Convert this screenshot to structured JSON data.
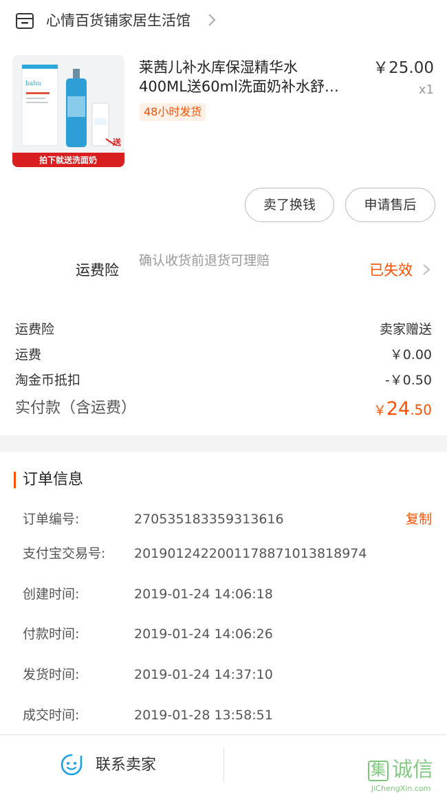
{
  "shop": {
    "name": "心情百货铺家居生活馆"
  },
  "product": {
    "title_line1": "莱茜儿补水库保湿精华水",
    "title_line2": "400ML送60ml洗面奶补水舒…",
    "ship_tag": "48小时发货",
    "price": "￥25.00",
    "quantity": "x1",
    "image_brand_text": "bahu",
    "image_gift_tag": "送",
    "image_banner": "拍下就送洗面奶"
  },
  "actions": {
    "sell_label": "卖了换钱",
    "after_sale_label": "申请售后"
  },
  "insurance": {
    "label": "运费险",
    "description": "确认收货前退货可理赔",
    "status": "已失效"
  },
  "costs": [
    {
      "label": "运费险",
      "value": "卖家赠送"
    },
    {
      "label": "运费",
      "value": "￥0.00"
    },
    {
      "label": "淘金币抵扣",
      "value": "-￥0.50"
    }
  ],
  "paid": {
    "label": "实付款（含运费）",
    "currency": "￥",
    "integer": "24",
    "decimal": ".50"
  },
  "order_info": {
    "title": "订单信息",
    "copy_label": "复制",
    "rows": [
      {
        "label": "订单编号:",
        "value": "270535183359313616"
      },
      {
        "label": "支付宝交易号:",
        "value": "2019012422001178871013818974"
      },
      {
        "label": "创建时间:",
        "value": "2019-01-24 14:06:18"
      },
      {
        "label": "付款时间:",
        "value": "2019-01-24 14:06:26"
      },
      {
        "label": "发货时间:",
        "value": "2019-01-24 14:37:10"
      },
      {
        "label": "成交时间:",
        "value": "2019-01-28 13:58:51"
      }
    ]
  },
  "bottom": {
    "contact_label": "联系卖家"
  },
  "watermark": {
    "glyph": "集",
    "name": "诚信",
    "url": "JiChengXin.com"
  },
  "colors": {
    "accent": "#ff5000",
    "text": "#333333",
    "muted": "#999999",
    "band": "#f4f4f4"
  },
  "icons": [
    "shop-icon",
    "chevron-right-icon",
    "contact-seller-icon"
  ]
}
